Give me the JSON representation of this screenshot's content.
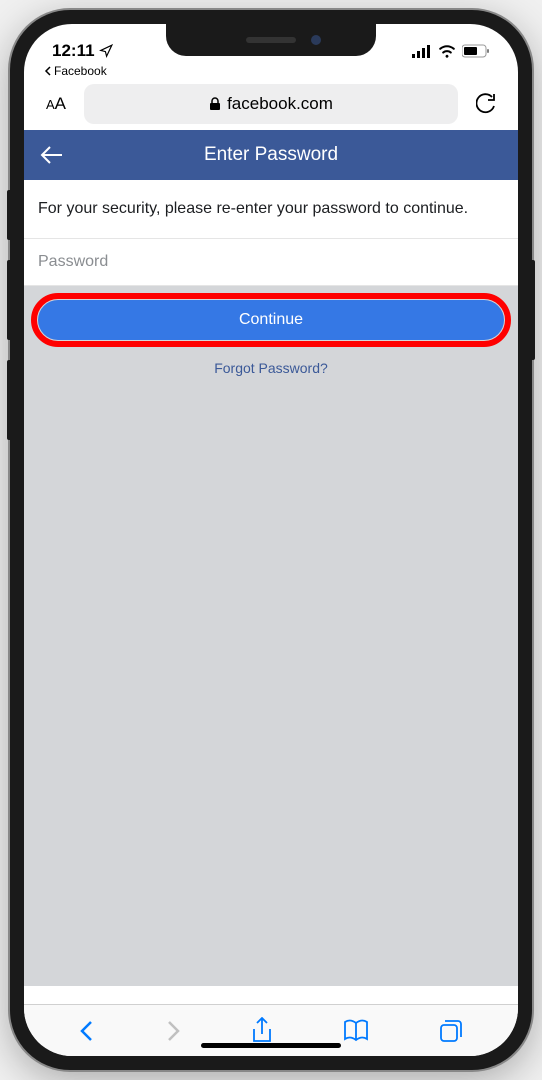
{
  "status": {
    "time": "12:11",
    "back_app": "Facebook"
  },
  "browser": {
    "url": "facebook.com"
  },
  "page": {
    "title": "Enter Password",
    "security_message": "For your security, please re-enter your password to continue.",
    "password_placeholder": "Password",
    "continue_label": "Continue",
    "forgot_label": "Forgot Password?"
  }
}
